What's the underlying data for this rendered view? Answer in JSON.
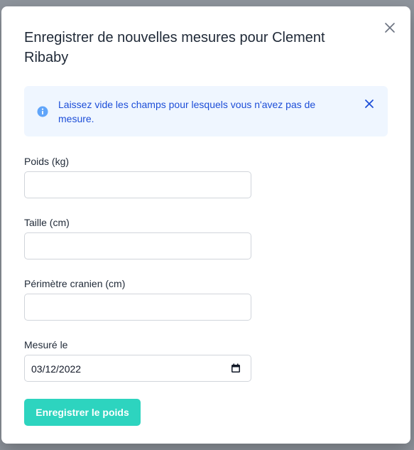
{
  "modal": {
    "title": "Enregistrer de nouvelles mesures pour Clement Ribaby",
    "close_icon": "close-icon"
  },
  "alert": {
    "icon": "info-icon",
    "message": "Laissez vide les champs pour lesquels vous n'avez pas de mesure.",
    "close_icon": "close-icon",
    "color": "#1d4ed8",
    "background": "#eff6ff"
  },
  "form": {
    "weight": {
      "label": "Poids (kg)",
      "value": ""
    },
    "height": {
      "label": "Taille (cm)",
      "value": ""
    },
    "head_circumference": {
      "label": "Périmètre cranien (cm)",
      "value": ""
    },
    "measured_on": {
      "label": "Mesuré le",
      "value": "03/12/2022",
      "icon": "calendar-icon"
    }
  },
  "submit": {
    "label": "Enregistrer le poids",
    "color": "#2dd4bf"
  }
}
